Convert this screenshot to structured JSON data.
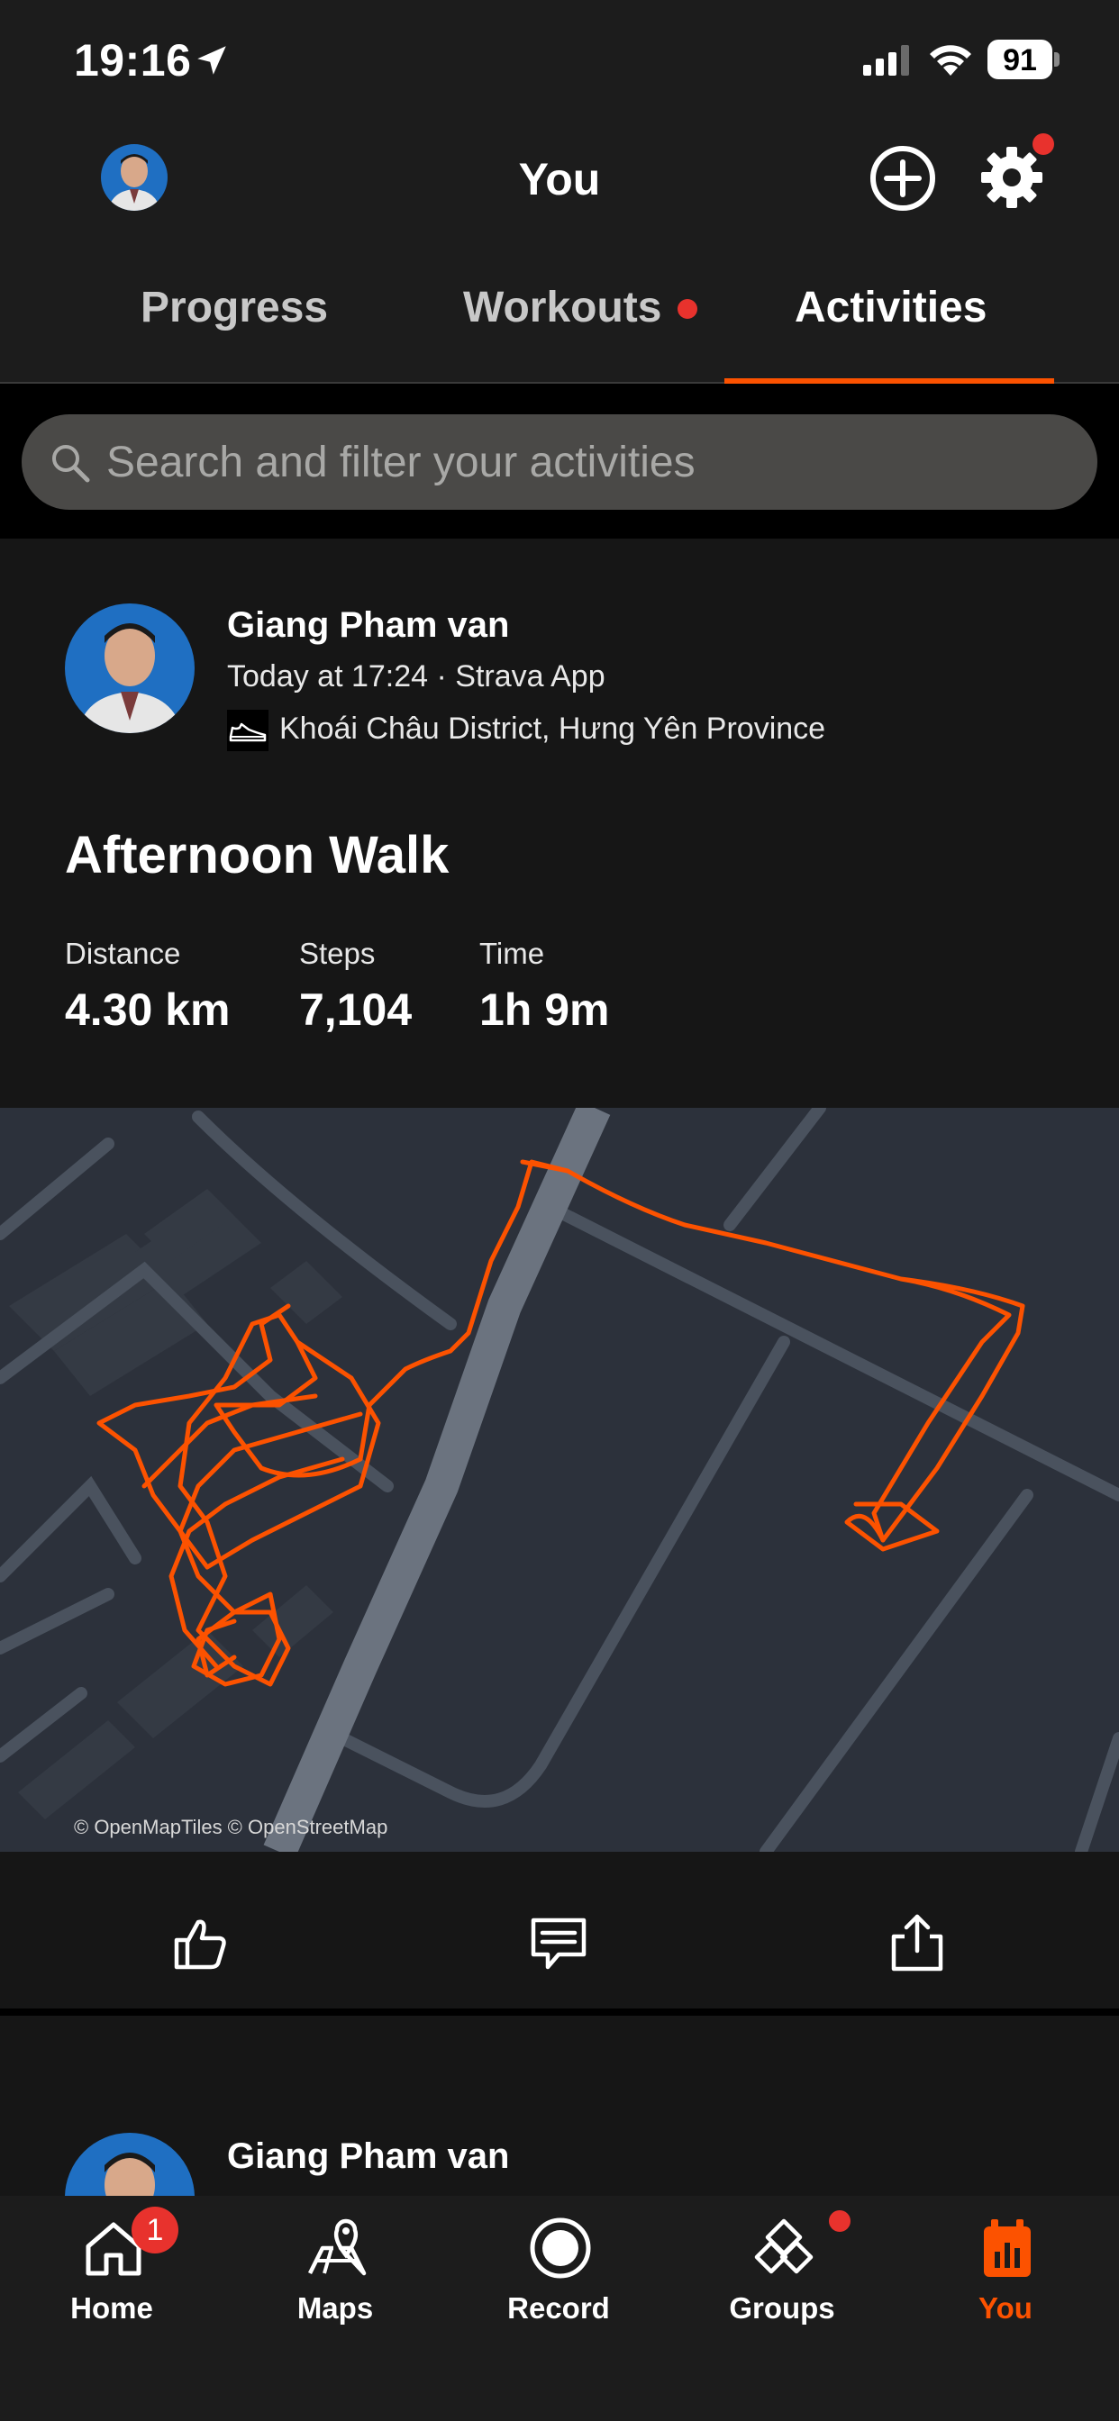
{
  "status_bar": {
    "time": "19:16",
    "battery": "91"
  },
  "header": {
    "title": "You"
  },
  "tabs": [
    {
      "label": "Progress",
      "active": false
    },
    {
      "label": "Workouts",
      "active": false,
      "dot": true
    },
    {
      "label": "Activities",
      "active": true
    }
  ],
  "search": {
    "placeholder": "Search and filter your activities"
  },
  "activity": {
    "athlete": "Giang Pham van",
    "meta": "Today at 17:24 · Strava App",
    "location": "Khoái Châu District, Hưng Yên Province",
    "title": "Afternoon Walk",
    "stats": [
      {
        "label": "Distance",
        "value": "4.30 km"
      },
      {
        "label": "Steps",
        "value": "7,104"
      },
      {
        "label": "Time",
        "value": "1h 9m"
      }
    ],
    "map_credit": "© OpenMapTiles © OpenStreetMap",
    "route_color": "#fc5200",
    "actions": [
      "thumbs-up-icon",
      "comment-icon",
      "share-icon"
    ]
  },
  "next_activity": {
    "athlete": "Giang Pham van"
  },
  "nav": {
    "items": [
      {
        "label": "Home",
        "icon": "home-icon",
        "badge": "1"
      },
      {
        "label": "Maps",
        "icon": "maps-icon"
      },
      {
        "label": "Record",
        "icon": "record-icon"
      },
      {
        "label": "Groups",
        "icon": "groups-icon",
        "dot": true
      },
      {
        "label": "You",
        "icon": "you-icon",
        "active": true
      }
    ]
  },
  "colors": {
    "accent": "#fc5200",
    "badge": "#e8322d",
    "background": "#1c1c1c",
    "card": "#161616"
  }
}
